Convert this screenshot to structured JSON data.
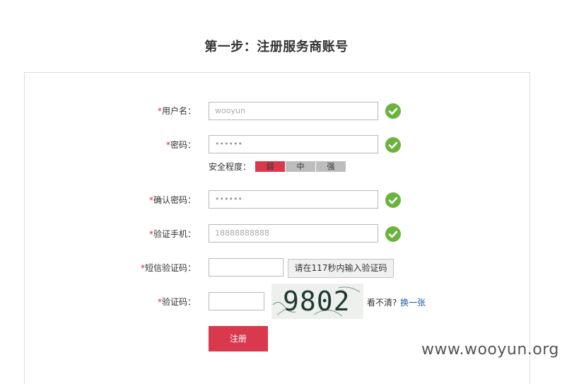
{
  "page": {
    "title": "第一步：注册服务商账号"
  },
  "form": {
    "username": {
      "label": "用户名：",
      "value": "wooyun"
    },
    "password": {
      "label": "密码：",
      "value": "••••••"
    },
    "strength": {
      "label": "安全程度：",
      "weak": "弱",
      "medium": "中",
      "strong": "强",
      "level": "weak"
    },
    "confirm": {
      "label": "确认密码：",
      "value": "••••••"
    },
    "phone": {
      "label": "验证手机：",
      "value": "18888888888"
    },
    "sms": {
      "label": "短信验证码：",
      "value": "",
      "button": "请在117秒内输入验证码"
    },
    "captcha": {
      "label": "验证码：",
      "value": "",
      "image_text": "9802",
      "unclear": "看不清?",
      "refresh": "换一张"
    },
    "submit": "注册",
    "required_mark": "*"
  },
  "watermark": "www.wooyun.org",
  "colors": {
    "accent": "#d8394d",
    "ok": "#6ab43e",
    "link": "#1d5fa6"
  }
}
